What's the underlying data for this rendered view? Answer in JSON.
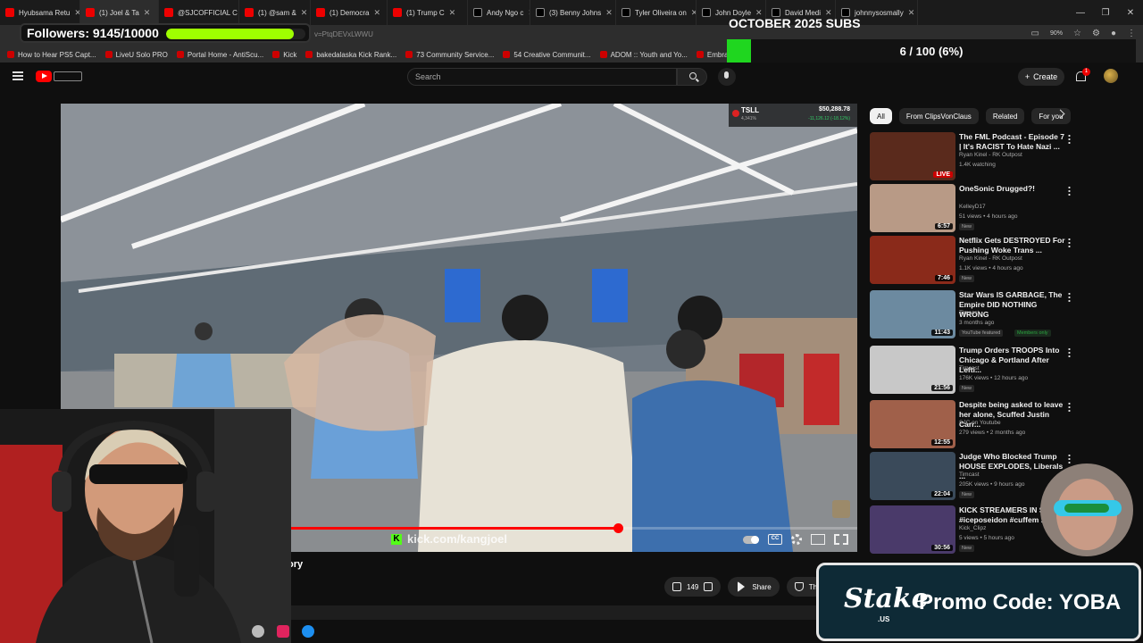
{
  "browser": {
    "tabs": [
      {
        "label": "Hyubsama Retu",
        "icon": "youtube-icon"
      },
      {
        "label": "(1) Joel & Ta",
        "icon": "youtube-icon",
        "active": true
      },
      {
        "label": "@SJCOFFICIAL C",
        "icon": "youtube-icon"
      },
      {
        "label": "(1) @sam &",
        "icon": "youtube-icon"
      },
      {
        "label": "(1) Democra",
        "icon": "youtube-icon"
      },
      {
        "label": "(1) Trump C",
        "icon": "youtube-icon"
      },
      {
        "label": "Andy Ngo c",
        "icon": "x-icon"
      },
      {
        "label": "(3) Benny Johns",
        "icon": "x-icon"
      },
      {
        "label": "Tyler Oliveira on",
        "icon": "x-icon"
      },
      {
        "label": "John Doyle",
        "icon": "x-icon"
      },
      {
        "label": "David Medi",
        "icon": "x-icon"
      },
      {
        "label": "johnnysosmally",
        "icon": "x-icon"
      }
    ],
    "url": "v=PtqDEVxLWWU",
    "zoom": "90%",
    "bookmarks": [
      "How to Hear PS5 Capt...",
      "LiveU Solo PRO",
      "Portal Home - AntiScu...",
      "Kick",
      "bakedalaska Kick Rank...",
      "73 Community Service...",
      "54 Creative Communit...",
      "ADOM :: Youth and Yo...",
      "Embracing the Cross a..."
    ]
  },
  "overlay": {
    "followers_label": "Followers: 9145/10000",
    "followers_fraction": 0.9145,
    "subs_title": "OCTOBER 2025 SUBS",
    "subs_count": "6 / 100 (6%)",
    "subs_fraction": 0.06,
    "stake_logo": "Stake",
    "stake_us": ".US",
    "stake_promo": "Promo Code: YOBA"
  },
  "youtube": {
    "search_placeholder": "Search",
    "create_label": "Create",
    "notification_count": "1",
    "video": {
      "progress_fraction": 0.7,
      "watermark": "kick.com/kangjoel",
      "title_fragment": "ory",
      "likes": "149",
      "share_label": "Share",
      "thanks_label": "Th",
      "captions": "CC"
    },
    "ticker": {
      "symbol": "TSLL",
      "price": "$50,288.78",
      "sub": "4,341%",
      "change": "-11,126.12 (-18.12%)"
    },
    "chips": [
      "All",
      "From ClipsVonClaus",
      "Related",
      "For you"
    ],
    "recommendations": [
      {
        "title": "The FML Podcast - Episode 7 | It's RACIST To Hate Nazi ...",
        "channel": "Ryan Kinel - RK Outpost",
        "meta": "1.4K watching",
        "duration": "LIVE",
        "live": true,
        "badge": "",
        "color": "#5a2a1c"
      },
      {
        "title": "OneSonic Drugged?!",
        "channel": "KelleyD17",
        "meta": "51 views • 4 hours ago",
        "duration": "6:57",
        "badge": "New",
        "color": "#b89a86"
      },
      {
        "title": "Netflix Gets DESTROYED For Pushing Woke Trans ...",
        "channel": "Ryan Kinel - RK Outpost",
        "meta": "1.1K views • 4 hours ago",
        "duration": "7:46",
        "badge": "New",
        "color": "#8a2a1a"
      },
      {
        "title": "Star Wars IS GARBAGE, The Empire DID NOTHING WRONG",
        "channel": "Timcast",
        "meta": "3 months ago",
        "duration": "11:43",
        "badge": "YouTube featured",
        "badge2": "Members only",
        "color": "#6c8aa0"
      },
      {
        "title": "Trump Orders TROOPS Into Chicago & Portland After Lefti...",
        "channel": "Timcast",
        "meta": "176K views • 12 hours ago",
        "duration": "21:56",
        "badge": "New",
        "color": "#c8c8c8"
      },
      {
        "title": "Despite being asked to leave her alone, Scuffed Justin Carr...",
        "channel": "SJC on Youtube",
        "meta": "279 views • 2 months ago",
        "duration": "12:55",
        "badge": "",
        "color": "#a0604a"
      },
      {
        "title": "Judge Who Blocked Trump HOUSE EXPLODES, Liberals ...",
        "channel": "Timcast",
        "meta": "205K views • 9 hours ago",
        "duration": "22:04",
        "badge": "New",
        "color": "#3a4a5a"
      },
      {
        "title": "KICK STREAMERS IN SOR... #iceposeidon #cuffem ...",
        "channel": "Kick_Clipz",
        "meta": "5 views • 5 hours ago",
        "duration": "30:56",
        "badge": "New",
        "color": "#4a3a6a"
      }
    ]
  }
}
